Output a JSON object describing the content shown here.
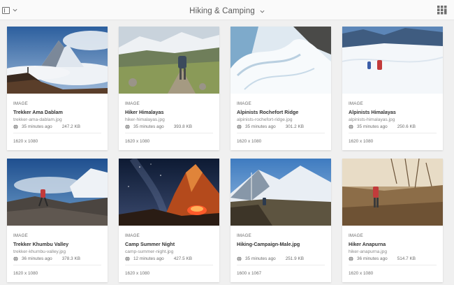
{
  "header": {
    "title": "Hiking & Camping",
    "rail_toggle_icon": "rail-panel-icon",
    "view_switch_icon": "card-view-icon"
  },
  "assets": [
    {
      "type": "IMAGE",
      "title": "Trekker Ama Dablam",
      "filename": "trekker-ama-dablam.jpg",
      "modified": "35 minutes ago",
      "size": "247.2 KB",
      "dimensions": "1620 x 1080"
    },
    {
      "type": "IMAGE",
      "title": "Hiker Himalayas",
      "filename": "hiker-himalayas.jpg",
      "modified": "35 minutes ago",
      "size": "393.8 KB",
      "dimensions": "1620 x 1080"
    },
    {
      "type": "IMAGE",
      "title": "Alpinists Rochefort Ridge",
      "filename": "alpinists-rochefort-ridge.jpg",
      "modified": "35 minutes ago",
      "size": "301.2 KB",
      "dimensions": "1620 x 1080"
    },
    {
      "type": "IMAGE",
      "title": "Alpinists Himalayas",
      "filename": "alpinists-himalayas.jpg",
      "modified": "35 minutes ago",
      "size": "250.6 KB",
      "dimensions": "1620 x 1080"
    },
    {
      "type": "IMAGE",
      "title": "Trekker Khumbu Valley",
      "filename": "trekker-khumbu-valley.jpg",
      "modified": "36 minutes ago",
      "size": "378.3 KB",
      "dimensions": "1620 x 1080"
    },
    {
      "type": "IMAGE",
      "title": "Camp Summer Night",
      "filename": "camp-summer-night.jpg",
      "modified": "12 minutes ago",
      "size": "427.5 KB",
      "dimensions": "1620 x 1080"
    },
    {
      "type": "IMAGE",
      "title": "Hiking-Campaign-Male.jpg",
      "filename": "",
      "modified": "35 minutes ago",
      "size": "251.9 KB",
      "dimensions": "1600 x 1067"
    },
    {
      "type": "IMAGE",
      "title": "Hiker Anapurna",
      "filename": "hiker-anapurna.jpg",
      "modified": "36 minutes ago",
      "size": "514.7 KB",
      "dimensions": "1620 x 1080"
    }
  ]
}
